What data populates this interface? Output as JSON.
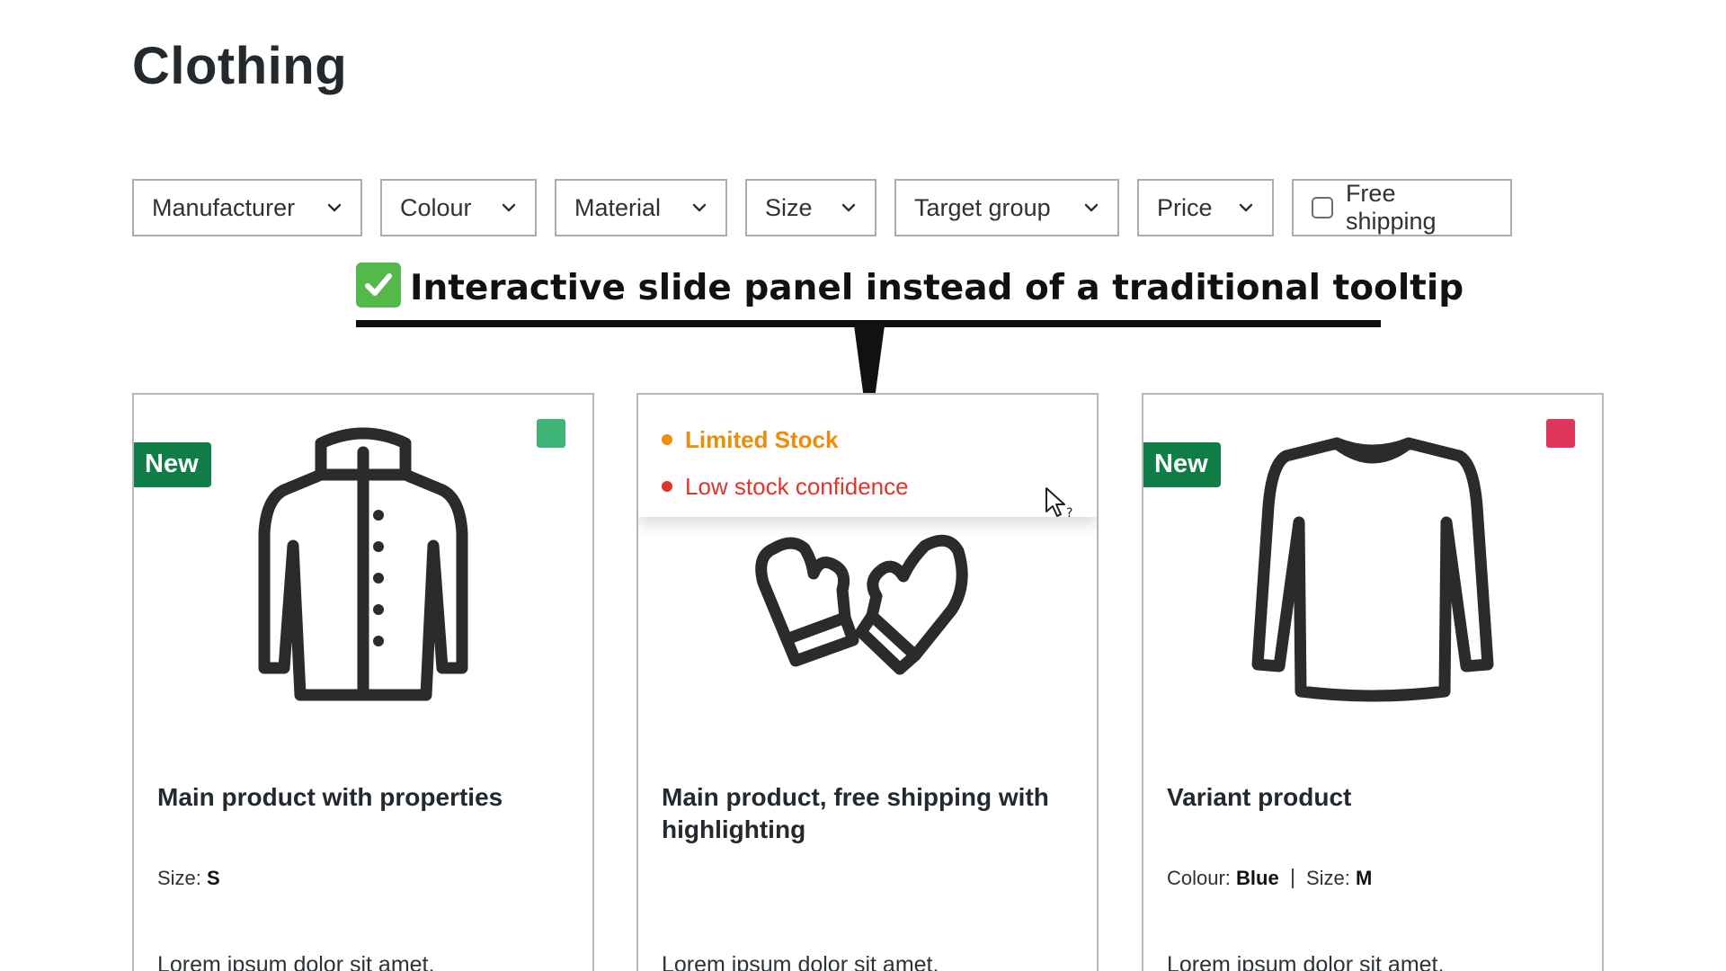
{
  "page": {
    "title": "Clothing"
  },
  "filters": {
    "manufacturer": "Manufacturer",
    "colour": "Colour",
    "material": "Material",
    "size": "Size",
    "target_group": "Target group",
    "price": "Price",
    "free_shipping": "Free shipping"
  },
  "annotation": {
    "text": "Interactive slide panel instead of a traditional tooltip"
  },
  "products": [
    {
      "badge": "New",
      "swatch_color": "#3fb578",
      "icon": "jacket-icon",
      "name": "Main product with properties",
      "props": {
        "size_label": "Size:",
        "size_value": "S"
      },
      "description": "Lorem ipsum dolor sit amet,"
    },
    {
      "icon": "mittens-icon",
      "name": "Main product, free shipping with highlighting",
      "panel": {
        "limited": "Limited Stock",
        "low": "Low stock confidence"
      },
      "description": "Lorem ipsum dolor sit amet,"
    },
    {
      "badge": "New",
      "swatch_color": "#e0365c",
      "icon": "sweater-icon",
      "name": "Variant product",
      "props": {
        "colour_label": "Colour:",
        "colour_value": "Blue",
        "size_label": "Size:",
        "size_value": "M"
      },
      "description": "Lorem ipsum dolor sit amet,"
    }
  ]
}
